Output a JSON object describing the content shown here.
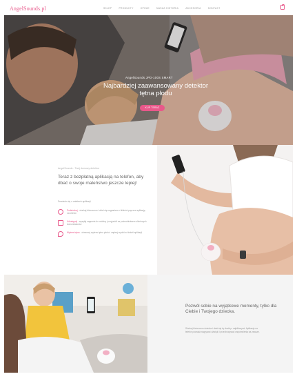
{
  "header": {
    "logo": "AngelSounds.pl",
    "nav": [
      "Sklep",
      "Produkty",
      "Opinie",
      "Nasza historia",
      "Akcesoria",
      "Kontakt"
    ],
    "cart_icon": "shopping-bag-icon"
  },
  "hero": {
    "subtitle": "AngelSounds JPD-100S SMART",
    "title": "Najbardziej zaawansowany detektor tętna płodu",
    "cta": "Kup teraz"
  },
  "section2": {
    "breadcrumb": "AngelSounds - Twój domowy detektor",
    "title": "Teraz z bezpłatną aplikacją na telefon, aby dbać o swoje maleństwo jeszcze lepiej!",
    "description": "Dowiedz się o zaletach aplikacji",
    "features": [
      {
        "icon": "waveform-icon",
        "name": "Podsłuchaj",
        "text": " - słuchaj bicia serca i dziel się nagraniem z bliskimi poprzez aplikację na telefon"
      },
      {
        "icon": "share-icon",
        "name": "Udostępnij",
        "text": " - wysyłaj nagrania do rodziny i przyjaciół za pośrednictwem ulubionych komunikatorów"
      },
      {
        "icon": "heart-icon",
        "name": "Wykres tętna",
        "text": " - obserwuj wykres tętna płodu i zapisuj wyniki w historii aplikacji"
      }
    ]
  },
  "section3": {
    "title": "Pozwól sobie na wyjątkowe momenty, tylko dla Ciebie i Twojego dziecka.",
    "body": "Słuchaj bicia serca dziecka i dziel się tą chwilą z najbliższymi. Aplikacja na telefon pozwala nagrywać dźwięki i przechowywać wspomnienia na zawsze."
  },
  "colors": {
    "accent": "#e8588a",
    "text": "#666666",
    "muted": "#999999",
    "panel": "#f4f4f4"
  }
}
